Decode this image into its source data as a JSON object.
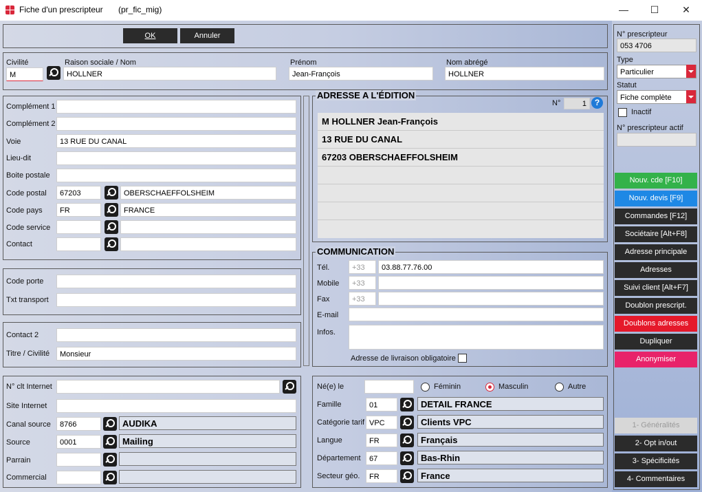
{
  "window": {
    "title": "Fiche d'un prescripteur",
    "subtitle": "(pr_fic_mig)",
    "minimize": "—",
    "maximize": "☐",
    "close": "✕"
  },
  "toolbar": {
    "ok": "OK",
    "cancel": "Annuler"
  },
  "identity": {
    "civilite_label": "Civilité",
    "civilite_value": "M",
    "raison_label": "Raison sociale / Nom",
    "raison_value": "HOLLNER",
    "prenom_label": "Prénom",
    "prenom_value": "Jean-François",
    "nom_abrege_label": "Nom abrégé",
    "nom_abrege_value": "HOLLNER"
  },
  "address": {
    "complement1_label": "Complément 1",
    "complement1_value": "",
    "complement2_label": "Complément 2",
    "complement2_value": "",
    "voie_label": "Voie",
    "voie_value": "13 RUE DU CANAL",
    "lieudit_label": "Lieu-dit",
    "lieudit_value": "",
    "bp_label": "Boite postale",
    "bp_value": "",
    "cp_label": "Code postal",
    "cp_value": "67203",
    "ville_value": "OBERSCHAEFFOLSHEIM",
    "pays_label": "Code pays",
    "pays_code": "FR",
    "pays_name": "FRANCE",
    "service_label": "Code service",
    "service_code": "",
    "service_name": "",
    "contact_label": "Contact",
    "contact_code": "",
    "contact_name": ""
  },
  "porte": {
    "code_porte_label": "Code porte",
    "code_porte_value": "",
    "txt_transport_label": "Txt transport",
    "txt_transport_value": ""
  },
  "contact2": {
    "contact2_label": "Contact 2",
    "contact2_value": "",
    "titre_label": "Titre / Civilité",
    "titre_value": "Monsieur"
  },
  "edition": {
    "title": "ADRESSE A L'ÉDITION",
    "num_label": "N°",
    "num_value": "1",
    "help": "?",
    "lines": [
      "M HOLLNER Jean-François",
      "13 RUE DU CANAL",
      "67203 OBERSCHAEFFOLSHEIM",
      "",
      "",
      "",
      ""
    ]
  },
  "communication": {
    "title": "COMMUNICATION",
    "tel_label": "Tél.",
    "tel_prefix": "+33",
    "tel_value": "03.88.77.76.00",
    "mobile_label": "Mobile",
    "mobile_prefix": "+33",
    "mobile_value": "",
    "fax_label": "Fax",
    "fax_prefix": "+33",
    "fax_value": "",
    "email_label": "E-mail",
    "email_value": "",
    "infos_label": "Infos.",
    "infos_value": "",
    "livraison_label": "Adresse de livraison obligatoire"
  },
  "internet": {
    "clt_label": "N° clt Internet",
    "clt_value": "",
    "site_label": "Site Internet",
    "site_value": "",
    "canal_label": "Canal source",
    "canal_code": "8766",
    "canal_name": "AUDIKA",
    "source_label": "Source",
    "source_code": "0001",
    "source_name": "Mailing",
    "parrain_label": "Parrain",
    "parrain_code": "",
    "parrain_name": "",
    "commercial_label": "Commercial",
    "commercial_code": "",
    "commercial_name": ""
  },
  "profile": {
    "ne_label": "Né(e) le",
    "ne_value": "",
    "feminin": "Féminin",
    "masculin": "Masculin",
    "autre": "Autre",
    "famille_label": "Famille",
    "famille_code": "01",
    "famille_name": "DETAIL FRANCE",
    "tarif_label": "Catégorie tarif",
    "tarif_code": "VPC",
    "tarif_name": "Clients VPC",
    "langue_label": "Langue",
    "langue_code": "FR",
    "langue_name": "Français",
    "dept_label": "Département",
    "dept_code": "67",
    "dept_name": "Bas-Rhin",
    "secteur_label": "Secteur géo.",
    "secteur_code": "FR",
    "secteur_name": "France"
  },
  "sidebar": {
    "num_label": "N° prescripteur",
    "num_value": "053 4706",
    "type_label": "Type",
    "type_value": "Particulier",
    "statut_label": "Statut",
    "statut_value": "Fiche complète",
    "inactif_label": "Inactif",
    "actif_label": "N° prescripteur actif",
    "actif_value": "",
    "buttons": [
      "Nouv. cde [F10]",
      "Nouv. devis [F9]",
      "Commandes [F12]",
      "Sociétaire [Alt+F8]",
      "Adresse principale",
      "Adresses",
      "Suivi client [Alt+F7]",
      "Doublon prescript.",
      "Doublons adresses",
      "Dupliquer",
      "Anonymiser"
    ],
    "tabs": [
      "1- Généralités",
      "2- Opt in/out",
      "3- Spécificités",
      "4- Commentaires"
    ]
  },
  "colors": {
    "green": "#33b24a",
    "blue": "#1e88e5",
    "red": "#e5192b",
    "pink": "#e8236a",
    "dark": "#2b2b2b"
  }
}
